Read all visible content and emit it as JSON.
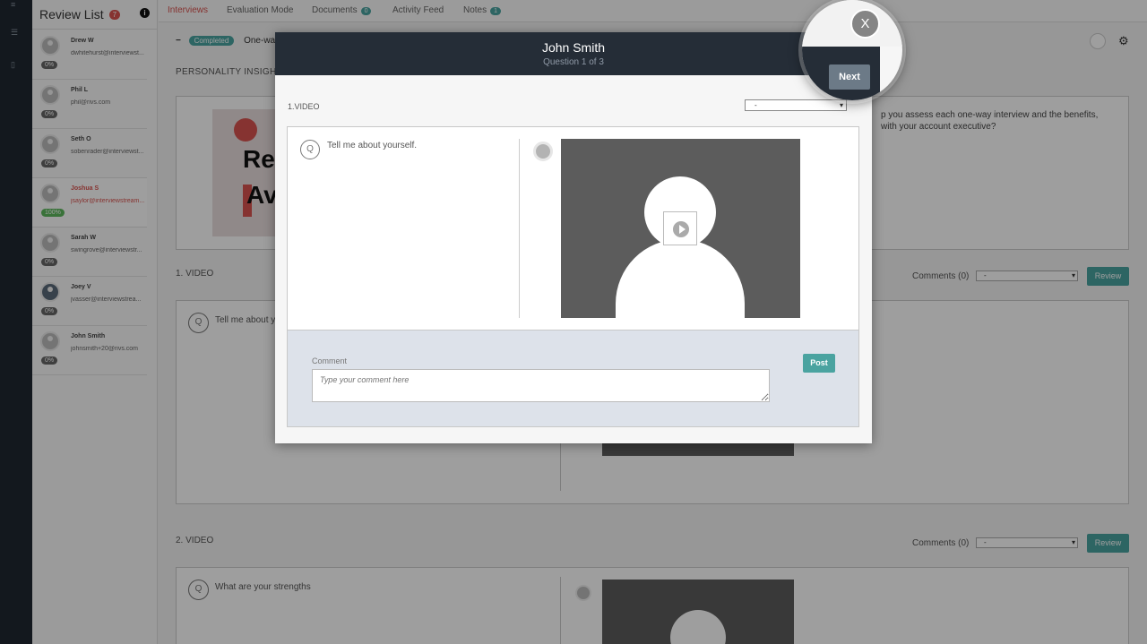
{
  "sidebar": {
    "title": "Review List",
    "count": "7",
    "info_icon": "info-icon",
    "candidates": [
      {
        "name": "Drew W",
        "email": "dwhitehurst@interviewst...",
        "pct": "0%"
      },
      {
        "name": "Phil L",
        "email": "phil@rivs.com",
        "pct": "0%"
      },
      {
        "name": "Seth O",
        "email": "sobenrader@interviewst...",
        "pct": "0%"
      },
      {
        "name": "Joshua S",
        "email": "jsaylor@interviewstream...",
        "pct": "100%"
      },
      {
        "name": "Sarah W",
        "email": "swingrove@interviewstr...",
        "pct": "0%"
      },
      {
        "name": "Joey V",
        "email": "jvasser@interviewstrea...",
        "pct": "0%"
      },
      {
        "name": "John Smith",
        "email": "johnsmith+20@rivs.com",
        "pct": "0%"
      }
    ]
  },
  "tabs": [
    {
      "label": "Interviews"
    },
    {
      "label": "Evaluation Mode"
    },
    {
      "label": "Documents",
      "badge": "0"
    },
    {
      "label": "Activity Feed"
    },
    {
      "label": "Notes",
      "badge": "1"
    }
  ],
  "main": {
    "collapse_symbol": "−",
    "status": "Completed",
    "status_suffix": "One-way",
    "personality_label": "PERSONALITY INSIGHTS",
    "personality_img_text1": "Rep",
    "personality_img_text2": "Av",
    "personality_desc": "p you assess each one-way interview and the benefits, with your account executive?",
    "sections": [
      {
        "label": "1. VIDEO",
        "comments": "Comments (0)",
        "select": "-",
        "review": "Review",
        "question": "Tell me about yo"
      },
      {
        "label": "2. VIDEO",
        "comments": "Comments (0)",
        "select": "-",
        "review": "Review",
        "question": "What are your strengths"
      }
    ],
    "q_symbol": "Q"
  },
  "modal": {
    "title": "John Smith",
    "subtitle": "Question 1 of 3",
    "section": "1.VIDEO",
    "select_value": "-",
    "q_symbol": "Q",
    "question": "Tell me about yourself.",
    "comment_label": "Comment",
    "comment_placeholder": "Type your comment here",
    "post_label": "Post",
    "next_label": "Next",
    "close_label": "X"
  },
  "colors": {
    "accent": "#4aa3a0",
    "alert": "#d9534f",
    "header_dark": "#252d37"
  }
}
